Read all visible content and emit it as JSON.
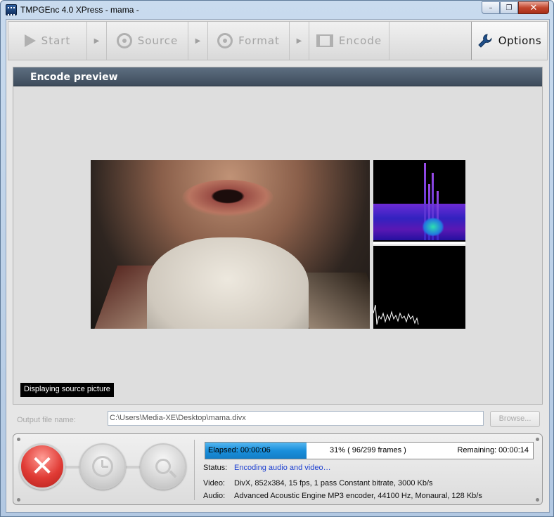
{
  "window": {
    "title": "TMPGEnc 4.0 XPress - mama -",
    "minimize_glyph": "–",
    "restore_glyph": "❐",
    "close_glyph": "✕"
  },
  "toolbar": {
    "start_label": "Start",
    "source_label": "Source",
    "format_label": "Format",
    "encode_label": "Encode",
    "options_label": "Options",
    "arrow_glyph": "▶"
  },
  "preview": {
    "header": "Encode preview",
    "status_tag": "Displaying source picture"
  },
  "output": {
    "label": "Output file name:",
    "value": "C:\\Users\\Media-XE\\Desktop\\mama.divx",
    "browse_label": "Browse..."
  },
  "progress": {
    "elapsed": "Elapsed: 00:00:06",
    "percent_text": "31% ( 96/299  frames )",
    "remaining": "Remaining: 00:00:14",
    "fraction": 0.31
  },
  "info": {
    "status_key": "Status:",
    "status_value": "Encoding audio and video…",
    "video_key": "Video:",
    "video_value": "DivX, 852x384, 15 fps, 1 pass Constant bitrate, 3000 Kb/s",
    "audio_key": "Audio:",
    "audio_value": "Advanced Acoustic Engine MP3 encoder, 44100  Hz, Monaural, 128 Kb/s"
  },
  "controls": {
    "stop_glyph": "✕"
  },
  "colors": {
    "accent_blue": "#1a8fdb",
    "stop_red": "#e03b35",
    "status_blue": "#1c3fd1",
    "header_dark": "#4a5868"
  }
}
